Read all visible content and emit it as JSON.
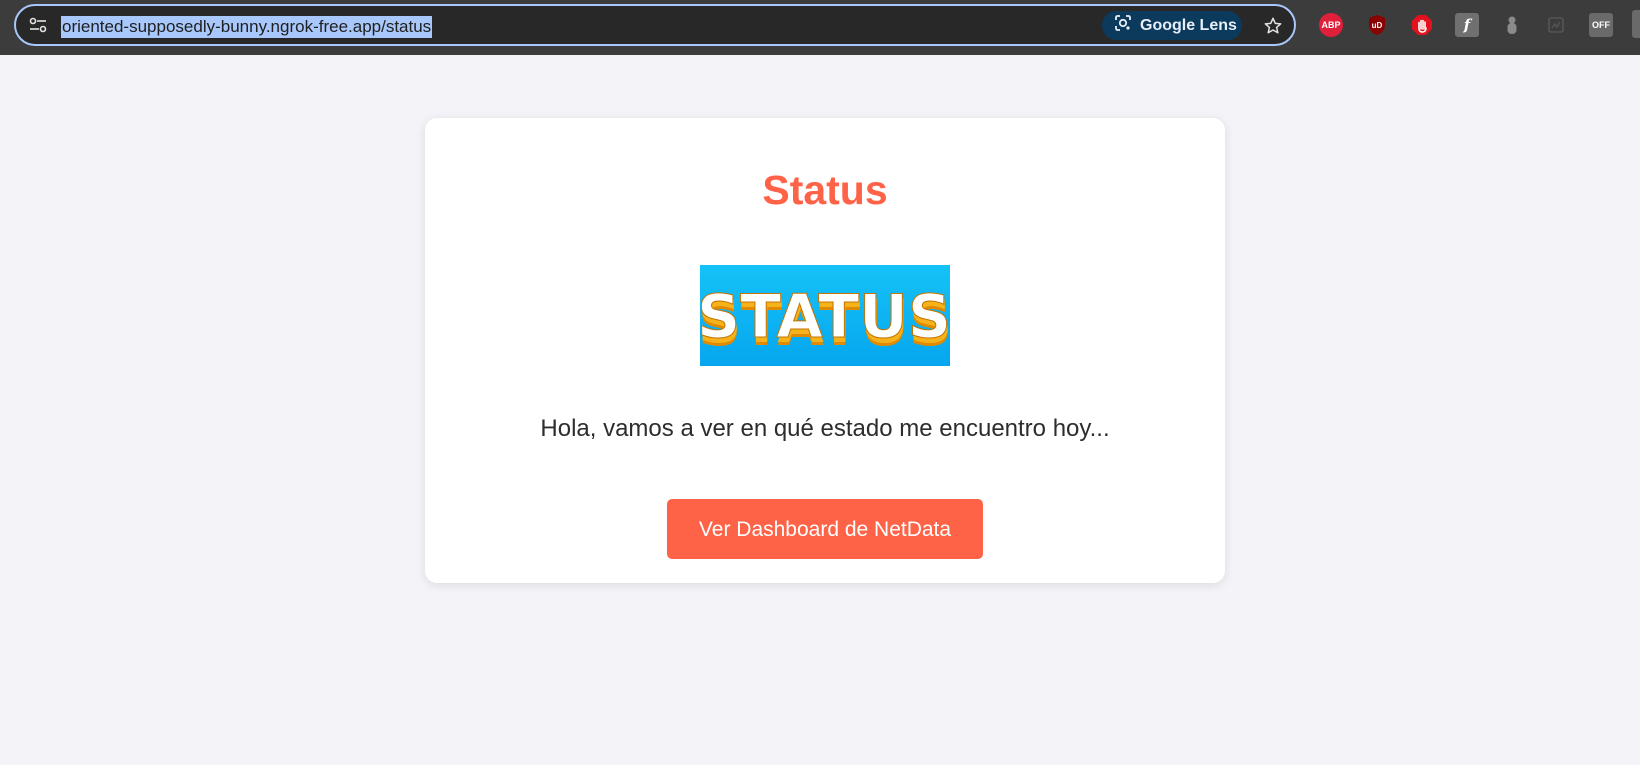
{
  "browser": {
    "url": "oriented-supposedly-bunny.ngrok-free.app/status",
    "lens_label": "Google Lens",
    "site_info_icon": "tune-icon",
    "bookmark_icon": "star-icon",
    "extensions": [
      {
        "name": "adblock-plus-icon",
        "label": "ABP"
      },
      {
        "name": "ublock-origin-icon",
        "label": "uD"
      },
      {
        "name": "stop-hand-icon",
        "label": ""
      },
      {
        "name": "flash-icon",
        "label": "f"
      },
      {
        "name": "gray-extension-icon",
        "label": ""
      },
      {
        "name": "gray-extension-icon-2",
        "label": ""
      },
      {
        "name": "off-toggle-icon",
        "label": "OFF"
      }
    ]
  },
  "page": {
    "title": "Status",
    "banner_text": "STATUS",
    "message": "Hola, vamos a ver en qué estado me encuentro hoy...",
    "button_label": "Ver Dashboard de NetData"
  },
  "colors": {
    "accent": "#ff6347",
    "toolbar_bg": "#3c3c3c",
    "page_bg": "#f3f3f8",
    "banner_bg": "#0aaef0"
  }
}
